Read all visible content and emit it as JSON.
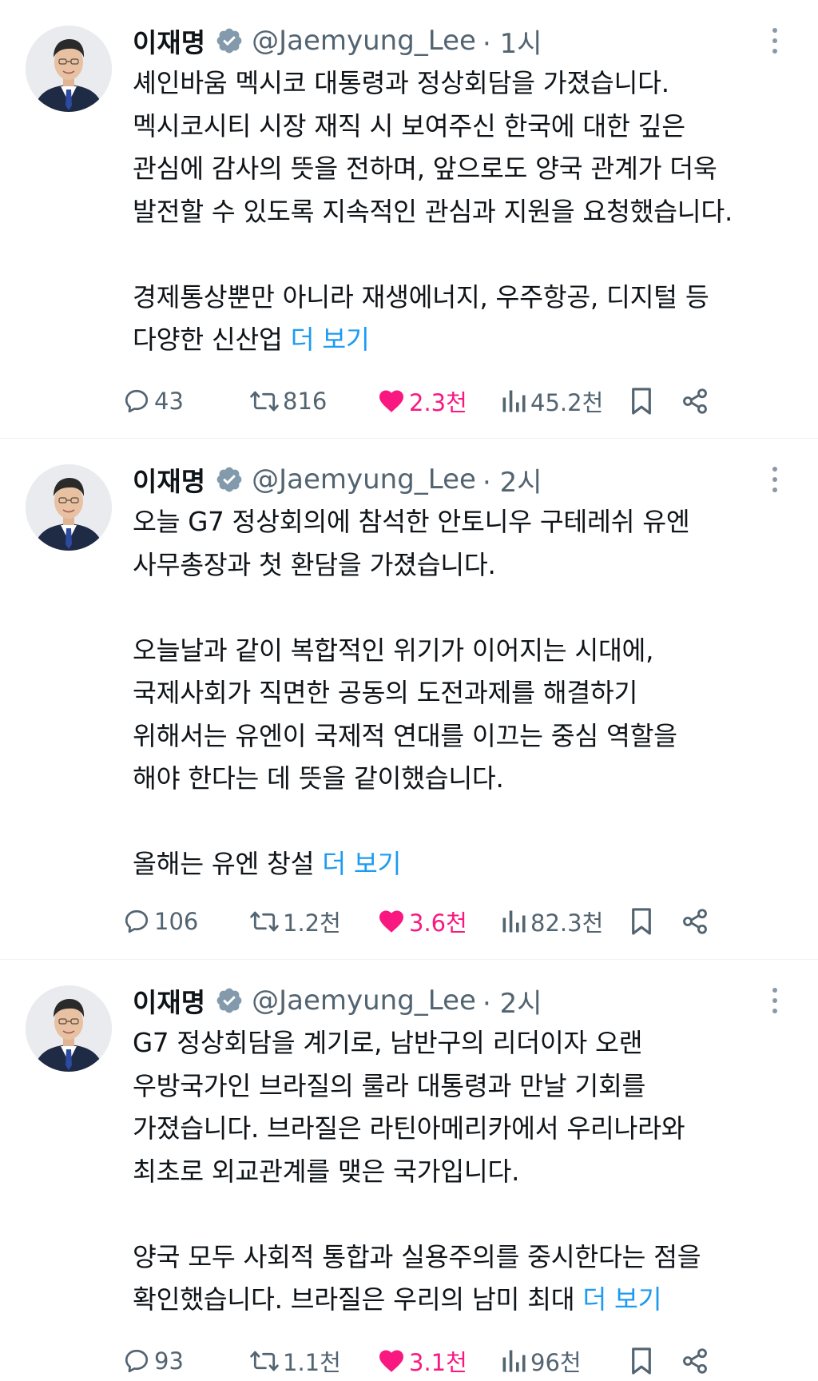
{
  "tweets": [
    {
      "author": "이재명",
      "handle": "@Jaemyung_Lee",
      "time": "· 1시",
      "lines": [
        "셰인바움 멕시코 대통령과 정상회담을 가졌습니다.",
        "멕시코시티 시장 재직 시 보여주신 한국에 대한 깊은",
        "관심에 감사의 뜻을 전하며, 앞으로도 양국 관계가 더욱",
        "발전할 수 있도록 지속적인 관심과 지원을 요청했습니다.",
        "",
        "경제통상뿐만 아니라 재생에너지, 우주항공, 디지털 등",
        "다양한 신산업 "
      ],
      "more": "더 보기",
      "replies": "43",
      "reposts": "816",
      "likes": "2.3천",
      "views": "45.2천"
    },
    {
      "author": "이재명",
      "handle": "@Jaemyung_Lee",
      "time": "· 2시",
      "lines": [
        "오늘 G7 정상회의에 참석한 안토니우 구테레쉬 유엔",
        "사무총장과 첫 환담을 가졌습니다.",
        "",
        "오늘날과 같이 복합적인 위기가 이어지는 시대에,",
        "국제사회가 직면한 공동의 도전과제를 해결하기",
        "위해서는 유엔이 국제적 연대를 이끄는 중심 역할을",
        "해야 한다는 데 뜻을 같이했습니다.",
        "",
        "올해는 유엔 창설 "
      ],
      "more": "더 보기",
      "replies": "106",
      "reposts": "1.2천",
      "likes": "3.6천",
      "views": "82.3천"
    },
    {
      "author": "이재명",
      "handle": "@Jaemyung_Lee",
      "time": "· 2시",
      "lines": [
        "G7 정상회담을 계기로, 남반구의 리더이자 오랜",
        "우방국가인 브라질의 룰라 대통령과 만날 기회를",
        "가졌습니다. 브라질은 라틴아메리카에서 우리나라와",
        "최초로 외교관계를 맺은 국가입니다.",
        "",
        "양국 모두 사회적 통합과 실용주의를 중시한다는 점을",
        "확인했습니다. 브라질은 우리의 남미 최대 "
      ],
      "more": "더 보기",
      "replies": "93",
      "reposts": "1.1천",
      "likes": "3.1천",
      "views": "96천"
    }
  ],
  "colors": {
    "text": "#0f1419",
    "secondary": "#536471",
    "link": "#1d9bf0",
    "like": "#f91880",
    "verified": "#829aab"
  },
  "icons": [
    "verified-badge-icon",
    "more-options-icon",
    "reply-icon",
    "repost-icon",
    "like-icon",
    "views-icon",
    "bookmark-icon",
    "share-icon"
  ]
}
